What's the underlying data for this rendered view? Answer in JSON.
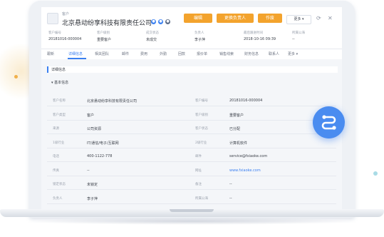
{
  "header": {
    "kind_label": "客户",
    "company_name": "北京悬动纷享科技有限责任公司",
    "buttons": {
      "edit": "编辑",
      "change_owner": "更换负责人",
      "void": "作废",
      "more": "更多"
    }
  },
  "summary_fields": [
    {
      "label": "客户编号",
      "value": "20181016-000004"
    },
    {
      "label": "客户级别",
      "value": "重要客户"
    },
    {
      "label": "成交状态",
      "value": "未成交"
    },
    {
      "label": "负责人",
      "value": "李子萍"
    },
    {
      "label": "最后跟进时间",
      "value": "2018-10-16 09:39"
    },
    {
      "label": "所属公海",
      "value": "--"
    }
  ],
  "tabs": [
    {
      "label": "跟新"
    },
    {
      "label": "详细信息"
    },
    {
      "label": "相关团队"
    },
    {
      "label": "邮件"
    },
    {
      "label": "费用"
    },
    {
      "label": "外勤"
    },
    {
      "label": "回款"
    },
    {
      "label": "报价单"
    },
    {
      "label": "销售线索"
    },
    {
      "label": "财务信息"
    },
    {
      "label": "联系人"
    },
    {
      "label": "更多"
    }
  ],
  "section_title": "详细信息",
  "subsection_title": "基本信息",
  "detail_rows": [
    {
      "l1": "客户名称",
      "v1": "北京悬动纷享科技有限责任公司",
      "l2": "客户编号",
      "v2": "20181016-000004"
    },
    {
      "l1": "客户类型",
      "v1": "客户",
      "l2": "客户级别",
      "v2": "重要客户"
    },
    {
      "l1": "来源",
      "v1": "公司资源",
      "l2": "客户状态",
      "v2": "已分配"
    },
    {
      "l1": "1级行业",
      "v1": "IT/通信/电子/互联网",
      "l2": "2级行业",
      "v2": "计算机软件"
    },
    {
      "l1": "电话",
      "v1": "400-1122-778",
      "l2": "邮件",
      "v2": "service@fxiaoke.com"
    },
    {
      "l1": "传真",
      "v1": "--",
      "l2": "网址",
      "v2": "www.fxiaoke.com"
    },
    {
      "l1": "锁定状态",
      "v1": "未锁定",
      "l2": "备注",
      "v2": "--"
    },
    {
      "l1": "负责人",
      "v1": "李子萍",
      "l2": "所属公海",
      "v2": "--"
    }
  ],
  "colors": {
    "accent": "#3a7ff0",
    "warning_button": "#f3a32d",
    "fab": "#4a8cf0"
  },
  "icons": {
    "refresh": "refresh-icon",
    "close": "close-icon",
    "fab": "swap-route-icon"
  }
}
